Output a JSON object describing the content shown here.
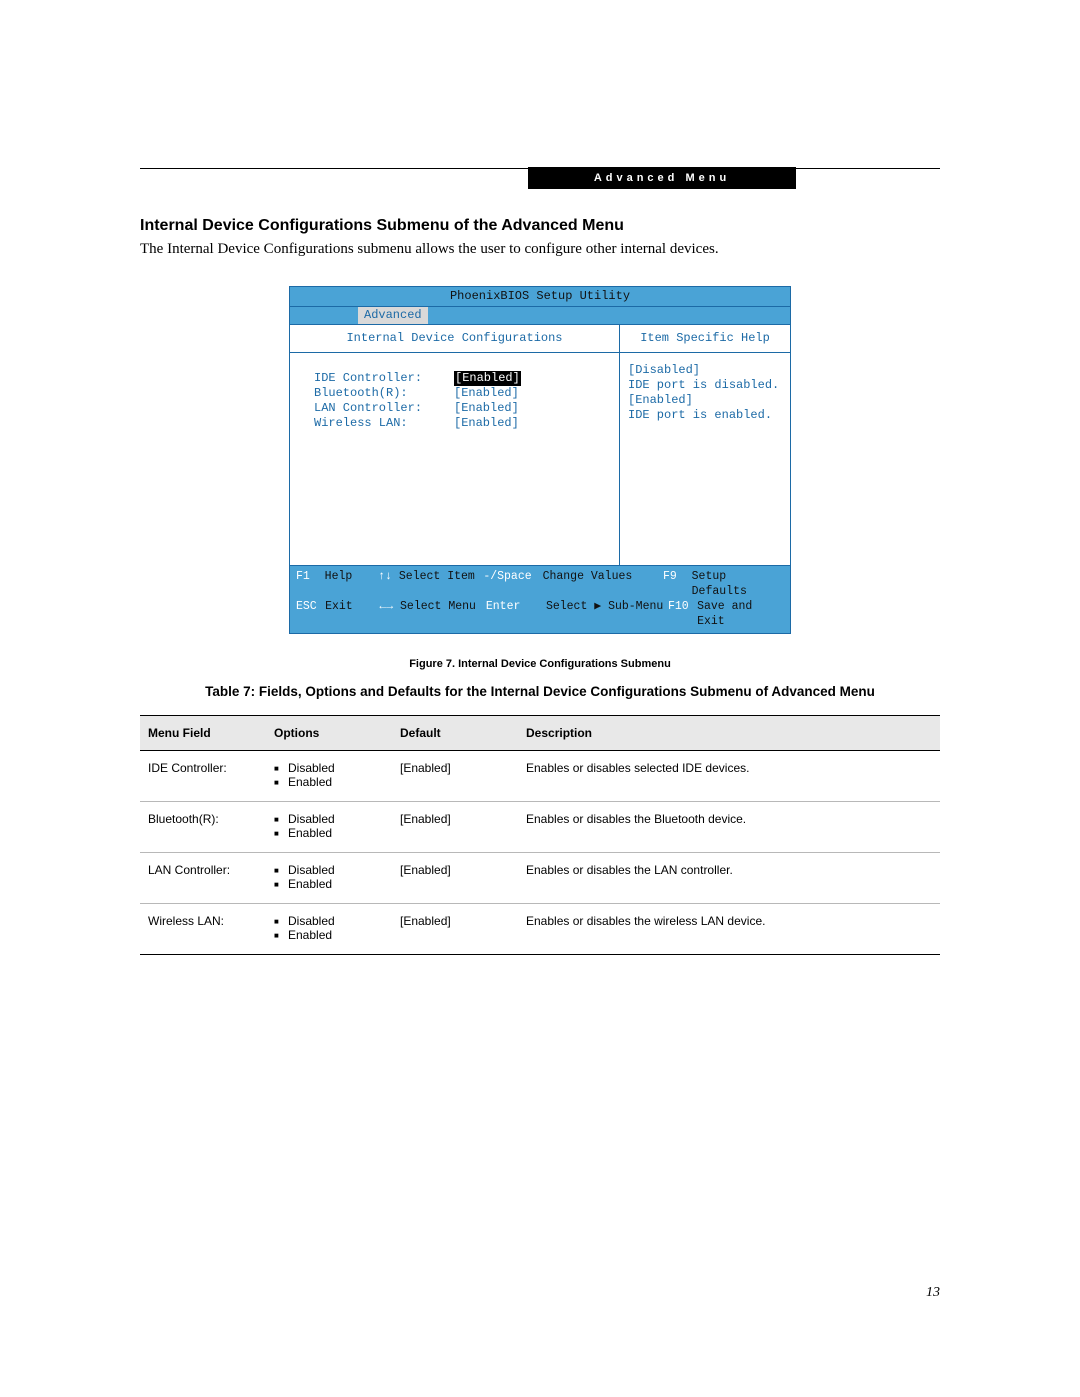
{
  "header_bar": "Advanced Menu",
  "section_title": "Internal Device Configurations Submenu of the Advanced Menu",
  "intro": "The Internal Device Configurations submenu allows the user to configure other internal devices.",
  "bios": {
    "title": "PhoenixBIOS Setup Utility",
    "tab": "Advanced",
    "left_heading": "Internal Device Configurations",
    "right_heading": "Item Specific Help",
    "rows": [
      {
        "label": "IDE Controller:",
        "value": "[Enabled]",
        "selected": true
      },
      {
        "label": "Bluetooth(R):",
        "value": "[Enabled]",
        "selected": false
      },
      {
        "label": "LAN Controller:",
        "value": "[Enabled]",
        "selected": false
      },
      {
        "label": "Wireless LAN:",
        "value": "[Enabled]",
        "selected": false
      }
    ],
    "help": [
      "[Disabled]",
      "IDE port is disabled.",
      "",
      "[Enabled]",
      "IDE port is enabled."
    ],
    "footer": {
      "r1": {
        "k1": "F1",
        "a1": "Help",
        "k2": "↑↓",
        "a2": "Select Item",
        "k3": "-/Space",
        "a3": "Change Values",
        "k4": "F9",
        "a4": "Setup Defaults"
      },
      "r2": {
        "k1": "ESC",
        "a1": "Exit",
        "k2": "←→",
        "a2": "Select Menu",
        "k3": "Enter",
        "a3": "Select ▶ Sub-Menu",
        "k4": "F10",
        "a4": "Save and Exit"
      }
    }
  },
  "figure_caption": "Figure 7.  Internal Device Configurations Submenu",
  "table_caption": "Table 7: Fields, Options and Defaults for the Internal Device Configurations Submenu of Advanced Menu",
  "table": {
    "headers": {
      "field": "Menu Field",
      "options": "Options",
      "default": "Default",
      "description": "Description"
    },
    "rows": [
      {
        "field": "IDE Controller:",
        "options": [
          "Disabled",
          "Enabled"
        ],
        "default": "[Enabled]",
        "description": "Enables or disables selected IDE devices."
      },
      {
        "field": "Bluetooth(R):",
        "options": [
          "Disabled",
          "Enabled"
        ],
        "default": "[Enabled]",
        "description": "Enables or disables the Bluetooth device."
      },
      {
        "field": "LAN Controller:",
        "options": [
          "Disabled",
          "Enabled"
        ],
        "default": "[Enabled]",
        "description": "Enables or disables the LAN controller."
      },
      {
        "field": "Wireless LAN:",
        "options": [
          "Disabled",
          "Enabled"
        ],
        "default": "[Enabled]",
        "description": "Enables or disables the wireless LAN device."
      }
    ]
  },
  "page_number": "13"
}
